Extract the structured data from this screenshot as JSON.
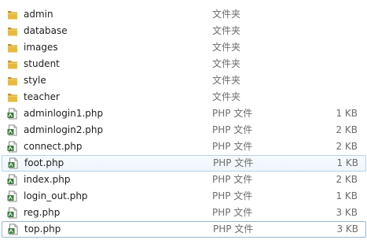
{
  "files": [
    {
      "name": "admin",
      "type": "文件夹",
      "size": "",
      "icon": "folder-icon",
      "state": "normal"
    },
    {
      "name": "database",
      "type": "文件夹",
      "size": "",
      "icon": "folder-icon",
      "state": "normal"
    },
    {
      "name": "images",
      "type": "文件夹",
      "size": "",
      "icon": "folder-icon",
      "state": "normal"
    },
    {
      "name": "student",
      "type": "文件夹",
      "size": "",
      "icon": "folder-icon",
      "state": "normal"
    },
    {
      "name": "style",
      "type": "文件夹",
      "size": "",
      "icon": "folder-icon",
      "state": "normal"
    },
    {
      "name": "teacher",
      "type": "文件夹",
      "size": "",
      "icon": "folder-icon",
      "state": "normal"
    },
    {
      "name": "adminlogin1.php",
      "type": "PHP 文件",
      "size": "1 KB",
      "icon": "php-file-icon",
      "state": "normal"
    },
    {
      "name": "adminlogin2.php",
      "type": "PHP 文件",
      "size": "2 KB",
      "icon": "php-file-icon",
      "state": "normal"
    },
    {
      "name": "connect.php",
      "type": "PHP 文件",
      "size": "2 KB",
      "icon": "php-file-icon",
      "state": "normal"
    },
    {
      "name": "foot.php",
      "type": "PHP 文件",
      "size": "1 KB",
      "icon": "php-file-icon",
      "state": "selected"
    },
    {
      "name": "index.php",
      "type": "PHP 文件",
      "size": "2 KB",
      "icon": "php-file-icon",
      "state": "normal"
    },
    {
      "name": "login_out.php",
      "type": "PHP 文件",
      "size": "1 KB",
      "icon": "php-file-icon",
      "state": "normal"
    },
    {
      "name": "reg.php",
      "type": "PHP 文件",
      "size": "3 KB",
      "icon": "php-file-icon",
      "state": "normal"
    },
    {
      "name": "top.php",
      "type": "PHP 文件",
      "size": "3 KB",
      "icon": "php-file-icon",
      "state": "focused"
    }
  ],
  "colors": {
    "folder": "#e8b93c",
    "folder_dark": "#c8961e",
    "php_green": "#3a7d3a",
    "selection_border": "#b7d2ea"
  }
}
